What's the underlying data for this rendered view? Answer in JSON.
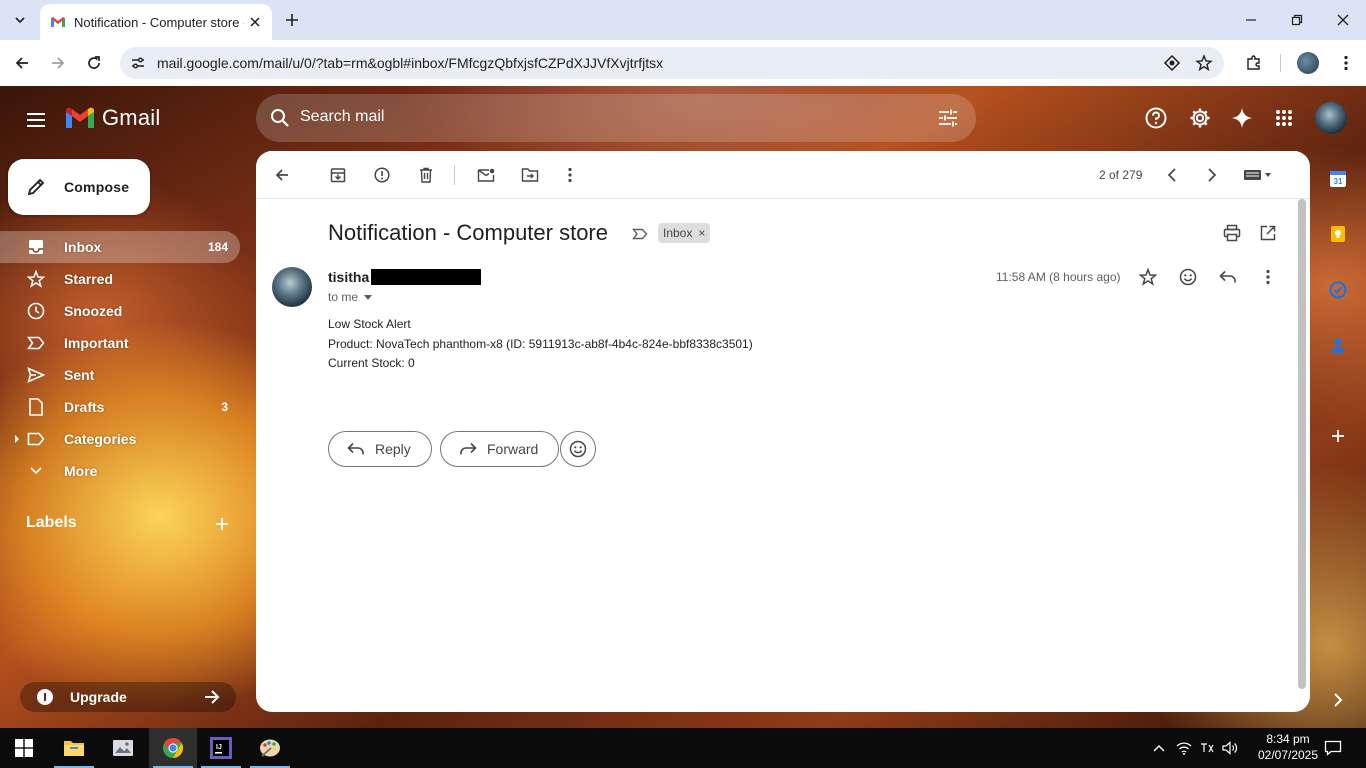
{
  "browser": {
    "tab_title": "Notification - Computer store -",
    "url": "mail.google.com/mail/u/0/?tab=rm&ogbl#inbox/FMfcgzQbfxjsfCZPdXJJVfXvjtrfjtsx"
  },
  "gmail": {
    "logo_text": "Gmail",
    "search_placeholder": "Search mail",
    "compose_label": "Compose",
    "nav": [
      {
        "label": "Inbox",
        "count": "184",
        "icon": "inbox-icon"
      },
      {
        "label": "Starred",
        "count": "",
        "icon": "star-icon"
      },
      {
        "label": "Snoozed",
        "count": "",
        "icon": "clock-icon"
      },
      {
        "label": "Important",
        "count": "",
        "icon": "important-icon"
      },
      {
        "label": "Sent",
        "count": "",
        "icon": "send-icon"
      },
      {
        "label": "Drafts",
        "count": "3",
        "icon": "draft-icon"
      },
      {
        "label": "Categories",
        "count": "",
        "icon": "label-icon"
      },
      {
        "label": "More",
        "count": "",
        "icon": "chevron-down-icon"
      }
    ],
    "labels_heading": "Labels",
    "upgrade_label": "Upgrade",
    "pager_text": "2 of 279"
  },
  "email": {
    "subject": "Notification - Computer store",
    "label_chip": "Inbox",
    "sender_name": "tisitha",
    "recipient": "to me",
    "timestamp": "11:58 AM (8 hours ago)",
    "body": [
      "Low Stock Alert",
      "Product: NovaTech phanthom-x8 (ID: 5911913c-ab8f-4b4c-824e-bbf8338c3501)",
      "Current Stock: 0"
    ],
    "reply_label": "Reply",
    "forward_label": "Forward"
  },
  "taskbar": {
    "time": "8:34 pm",
    "date": "02/07/2025"
  },
  "colors": {
    "gmail_red": "#ea4335",
    "gmail_blue": "#4285f4",
    "gmail_green": "#34a853",
    "gmail_yellow": "#fbbc04",
    "tabstrip": "#dbe4f4"
  }
}
